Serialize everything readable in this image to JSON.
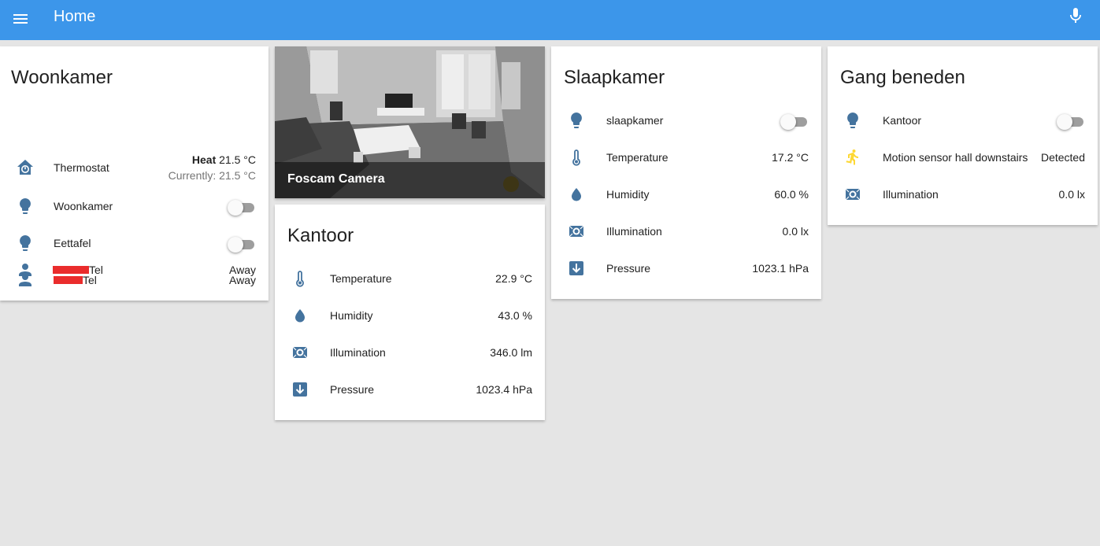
{
  "toolbar": {
    "title": "Home",
    "menu_icon": "menu-icon",
    "mic_icon": "microphone-icon",
    "background_color": "#3c96ea"
  },
  "colors": {
    "icon": "#44739e",
    "motion_active": "#fdd835"
  },
  "woonkamer": {
    "title": "Woonkamer",
    "thermostat": {
      "name": "Thermostat",
      "mode": "Heat",
      "target": "21.5 °C",
      "current": "Currently: 21.5 °C",
      "icon": "home-thermostat-icon"
    },
    "light_woonkamer": {
      "name": "Woonkamer",
      "icon": "lightbulb-icon",
      "on": false
    },
    "light_eettafel": {
      "name": "Eettafel",
      "icon": "lightbulb-icon",
      "on": false
    },
    "person_1": {
      "name": "Tel",
      "state": "Away",
      "icon": "account-icon"
    },
    "person_2": {
      "name": "Tel",
      "state": "Away",
      "icon": "account-icon"
    }
  },
  "camera": {
    "label": "Foscam Camera"
  },
  "kantoor": {
    "title": "Kantoor",
    "temperature": {
      "name": "Temperature",
      "state": "22.9 °C"
    },
    "humidity": {
      "name": "Humidity",
      "state": "43.0 %"
    },
    "illumination": {
      "name": "Illumination",
      "state": "346.0 lm"
    },
    "pressure": {
      "name": "Pressure",
      "state": "1023.4 hPa"
    }
  },
  "slaapkamer": {
    "title": "Slaapkamer",
    "light": {
      "name": "slaapkamer",
      "on": false
    },
    "temperature": {
      "name": "Temperature",
      "state": "17.2 °C"
    },
    "humidity": {
      "name": "Humidity",
      "state": "60.0 %"
    },
    "illumination": {
      "name": "Illumination",
      "state": "0.0 lx"
    },
    "pressure": {
      "name": "Pressure",
      "state": "1023.1 hPa"
    }
  },
  "gang": {
    "title": "Gang beneden",
    "light": {
      "name": "Kantoor",
      "on": false
    },
    "motion": {
      "name": "Motion sensor hall downstairs",
      "state": "Detected"
    },
    "illumination": {
      "name": "Illumination",
      "state": "0.0 lx"
    }
  }
}
